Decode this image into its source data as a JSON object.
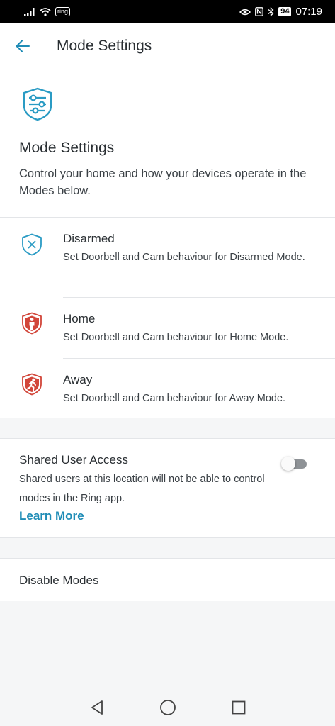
{
  "status_bar": {
    "carrier_badge": "ring",
    "battery": "94",
    "time": "07:19"
  },
  "header": {
    "title": "Mode Settings",
    "back_icon": "arrow-left-icon"
  },
  "intro": {
    "icon": "mode-sliders-shield-icon",
    "title": "Mode Settings",
    "description": "Control your home and how your devices operate in the Modes below."
  },
  "modes": [
    {
      "title": "Disarmed",
      "description": "Set Doorbell and Cam behaviour for Disarmed Mode.",
      "icon": "shield-x-icon"
    },
    {
      "title": "Home",
      "description": "Set Doorbell and Cam behaviour for Home Mode.",
      "icon": "shield-person-icon"
    },
    {
      "title": "Away",
      "description": "Set Doorbell and Cam behaviour for Away Mode.",
      "icon": "shield-running-icon"
    }
  ],
  "shared_access": {
    "title": "Shared User Access",
    "description": "Shared users at this location will not be able to control modes in the Ring app.",
    "learn_more": "Learn More",
    "toggle_on": false
  },
  "disable_modes": {
    "label": "Disable Modes"
  },
  "colors": {
    "accent": "#1f8cb6",
    "disarmed": "#2a9bc4",
    "armed": "#d2463a",
    "toggle_off": "#8e9296"
  },
  "navbar": [
    "back-triangle-icon",
    "home-circle-icon",
    "recents-square-icon"
  ]
}
